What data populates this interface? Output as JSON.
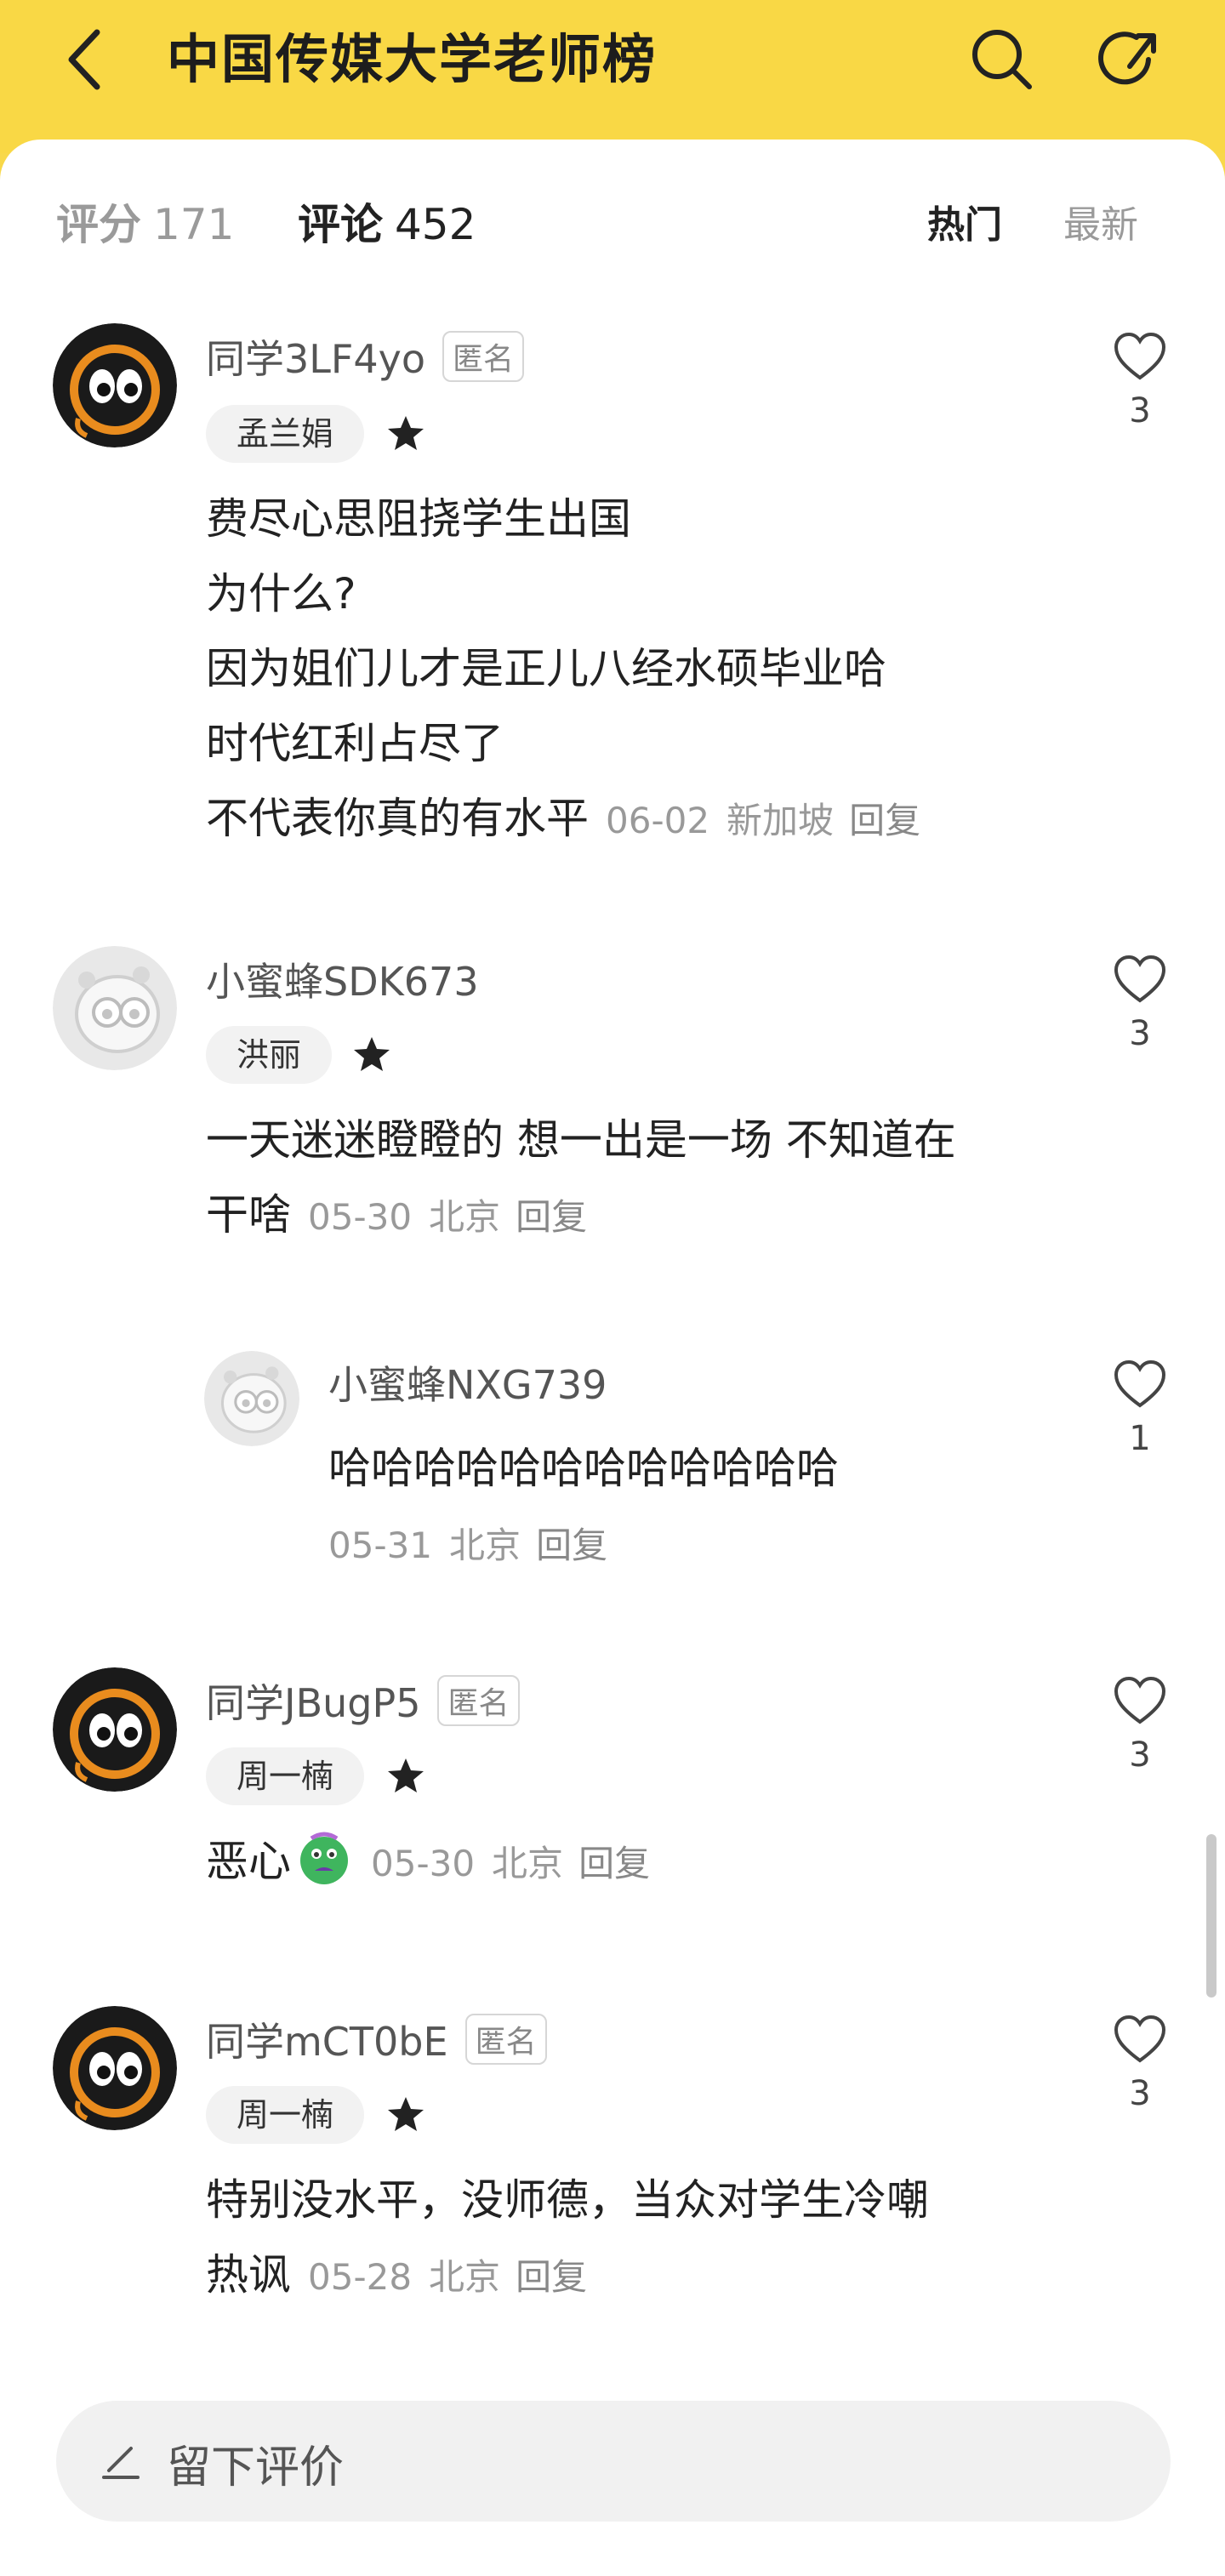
{
  "header": {
    "title": "中国传媒大学老师榜",
    "bg_color": "#f9d845"
  },
  "tabs": {
    "rating_label": "评分",
    "rating_count": "171",
    "comments_label": "评论",
    "comments_count": "452",
    "sort_hot": "热门",
    "sort_new": "最新"
  },
  "comments": [
    {
      "username": "同学3LF4yo",
      "anon_tag": "匿名",
      "teacher": "孟兰娟",
      "lines": [
        "费尽心思阻挠学生出国",
        "为什么?",
        "因为姐们儿才是正儿八经水硕毕业哈",
        "时代红利占尽了",
        "不代表你真的有水平"
      ],
      "date": "06-02",
      "location": "新加坡",
      "reply": "回复",
      "likes": "3",
      "avatar": "black-eyes-avatar"
    },
    {
      "username": "小蜜蜂SDK673",
      "teacher": "洪丽",
      "lines": [
        "一天迷迷瞪瞪的 想一出是一场 不知道在",
        "干啥"
      ],
      "date": "05-30",
      "location": "北京",
      "reply": "回复",
      "likes": "3",
      "avatar": "grey-bee-avatar"
    },
    {
      "username": "小蜜蜂NXG739",
      "lines": [
        "哈哈哈哈哈哈哈哈哈哈哈哈"
      ],
      "date": "05-31",
      "location": "北京",
      "reply": "回复",
      "likes": "1",
      "avatar": "grey-bee-avatar"
    },
    {
      "username": "同学JBugP5",
      "anon_tag": "匿名",
      "teacher": "周一楠",
      "lines": [
        "恶心"
      ],
      "date": "05-30",
      "location": "北京",
      "reply": "回复",
      "likes": "3",
      "avatar": "black-eyes-avatar",
      "emoji": "sick-face-emoji"
    },
    {
      "username": "同学mCT0bE",
      "anon_tag": "匿名",
      "teacher": "周一楠",
      "lines": [
        "特别没水平，没师德，当众对学生冷嘲",
        "热讽"
      ],
      "date": "05-28",
      "location": "北京",
      "reply": "回复",
      "likes": "3",
      "avatar": "black-eyes-avatar"
    }
  ],
  "review_input": {
    "placeholder": "留下评价"
  }
}
